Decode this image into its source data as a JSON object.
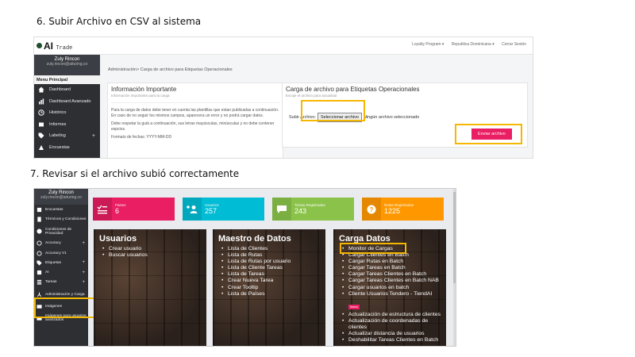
{
  "steps": {
    "step6": "6. Subir Archivo en CSV al sistema",
    "step7": "7. Revisar si el archivo subió correctamente"
  },
  "app": {
    "logo_text": "AI",
    "logo_sub": "Trade",
    "topnav": [
      "Loyalty Program ▾",
      "Republica Dominicana ▾",
      "Cerrar Sesión"
    ],
    "user_name": "Zuly Rincon",
    "user_email": "zuly.rincon@aituring.co"
  },
  "shot1": {
    "menu_header": "Menu Principal",
    "menu": [
      {
        "label": "Dashboard",
        "icon": "home-icon",
        "plus": ""
      },
      {
        "label": "Dashboard Avanzado",
        "icon": "chart-icon",
        "plus": ""
      },
      {
        "label": "Histórico",
        "icon": "history-icon",
        "plus": ""
      },
      {
        "label": "Informes",
        "icon": "report-icon",
        "plus": ""
      },
      {
        "label": "Labeling",
        "icon": "tag-icon",
        "plus": "+"
      },
      {
        "label": "Encuestas",
        "icon": "survey-icon",
        "plus": ""
      }
    ],
    "breadcrumb": "Administración> Carga de archivo para Etiquetas Operacionales",
    "info_card": {
      "title": "Información Importante",
      "subtitle": "Información importante para la carga",
      "p1": "Para la carga de datos debe tener en cuenta las plantillas que estan publicadas a continuación. En caso de no seguir los mismos campos, aparecera un error y no podrá cargar datos.",
      "p2": "Debe respetar la guiá a continuación, sus letras mayúsculas, minúsculas y no debe contener espcios.",
      "p3": "Formato de fechas: YYYY-MM-DD"
    },
    "upload_card": {
      "title": "Carga de archivo para Etiquetas Operacionales",
      "subtitle": "Escoje el archivo para actualizar",
      "field_label": "Subir Archivo:",
      "file_button": "Seleccionar archivo",
      "file_status": "Ningún archivo seleccionado",
      "send_button": "Enviar archivo"
    }
  },
  "shot2": {
    "menu": [
      {
        "label": "Encuestas",
        "icon": "survey-icon",
        "plus": ""
      },
      {
        "label": "Términos y Condiciones",
        "icon": "doc-icon",
        "plus": ""
      },
      {
        "label": "Condiciones de Privacidad",
        "icon": "check-circle-icon",
        "plus": ""
      },
      {
        "label": "Accuracy",
        "icon": "target-icon",
        "plus": "+"
      },
      {
        "label": "Accuracy V1",
        "icon": "target-icon",
        "plus": ""
      },
      {
        "label": "Etiquetas",
        "icon": "tag-icon",
        "plus": "+"
      },
      {
        "label": "AI",
        "icon": "ai-icon",
        "plus": "+"
      },
      {
        "label": "Tareas",
        "icon": "tasks-icon",
        "plus": "+"
      },
      {
        "label": "Administración y Carga",
        "icon": "sitemap-icon",
        "plus": ""
      },
      {
        "label": "Imágenes",
        "icon": "image-icon",
        "plus": ""
      },
      {
        "label": "Imágenes para usuarios avanzados",
        "icon": "image-icon",
        "plus": ""
      }
    ],
    "stats": [
      {
        "label": "Paises",
        "value": "6",
        "color": "#e91e63",
        "icon": "check-list-icon"
      },
      {
        "label": "Usuarios",
        "value": "257",
        "color": "#00bcd4",
        "icon": "add-user-icon"
      },
      {
        "label": "Tareas Registradas",
        "value": "243",
        "color": "#8bc34a",
        "icon": "chat-icon"
      },
      {
        "label": "Rutas Registradas",
        "value": "1225",
        "color": "#ff9800",
        "icon": "question-icon"
      }
    ],
    "panels": [
      {
        "title": "Usuarios",
        "items": [
          "Crear usuario",
          "Buscar usuarios"
        ]
      },
      {
        "title": "Maestro de Datos",
        "items": [
          "Lista de Clientes",
          "Lista de Rutas",
          "Lista de Rutas por usuario",
          "Lista de Cliente Tareas",
          "Lista de Tareas",
          "Crear Nueva Tarea",
          "Crear Tooltip",
          "Lista de Países"
        ]
      },
      {
        "title": "Carga Datos",
        "items": [
          "Monitor de Cargas",
          "Cargar Clientes en Batch",
          "Cargar Rutas en Batch",
          "Cargar Tareas en Batch",
          "Cargar Tareas Clientes en Batch",
          "Cargar Tareas Clientes en Batch NAB",
          "Cargar usuarios en batch",
          "Cliente Usuarios Tendero - TiendAI",
          "Actualización de estructura de clientes",
          "Actualización de coordenadas de clientes",
          "Actualizar distancia de usuarios",
          "Deshabilitar Tareas Clientes en Batch"
        ],
        "badge": "Nuevo"
      }
    ]
  }
}
